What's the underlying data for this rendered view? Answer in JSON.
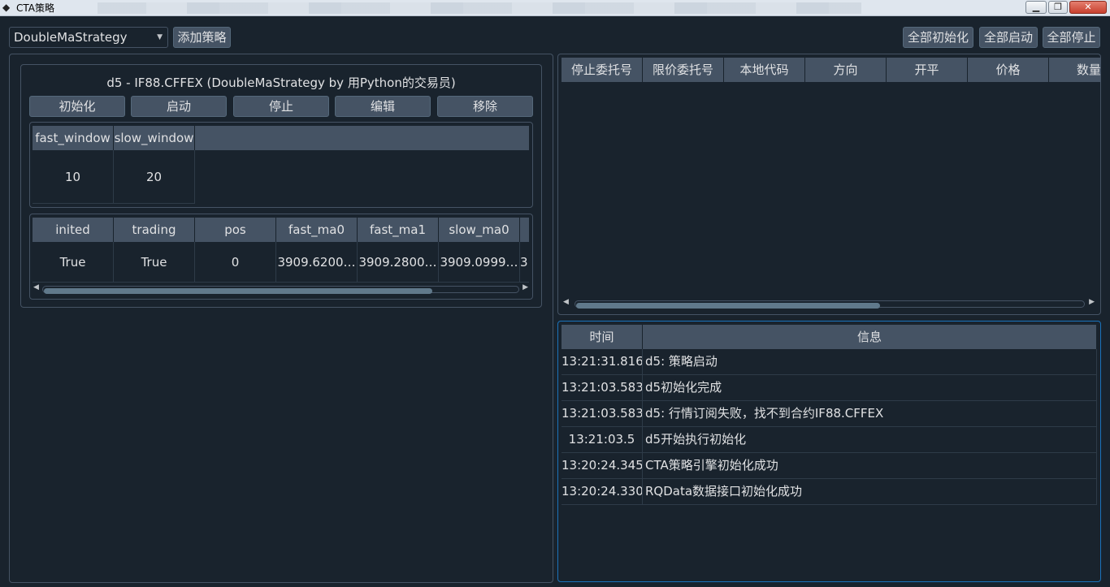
{
  "window": {
    "title": "CTA策略"
  },
  "toolbar": {
    "strategy_select": "DoubleMaStrategy",
    "add_strategy": "添加策略",
    "init_all": "全部初始化",
    "start_all": "全部启动",
    "stop_all": "全部停止"
  },
  "strategy": {
    "title": "d5  -  IF88.CFFEX  (DoubleMaStrategy by 用Python的交易员)",
    "buttons": [
      "初始化",
      "启动",
      "停止",
      "编辑",
      "移除"
    ],
    "params": {
      "headers": [
        "fast_window",
        "slow_window"
      ],
      "values": [
        "10",
        "20"
      ]
    },
    "variables": {
      "headers": [
        "inited",
        "trading",
        "pos",
        "fast_ma0",
        "fast_ma1",
        "slow_ma0"
      ],
      "values": [
        "True",
        "True",
        "0",
        "3909.6200…",
        "3909.2800…",
        "3909.0999…",
        "3"
      ]
    },
    "scroll_fraction": 0.82
  },
  "stop_orders": {
    "headers": [
      "停止委托号",
      "限价委托号",
      "本地代码",
      "方向",
      "开平",
      "价格",
      "数量"
    ],
    "scroll_fraction": 0.6
  },
  "log": {
    "headers": [
      "时间",
      "信息"
    ],
    "rows": [
      {
        "time": "13:21:31.816",
        "msg": "d5: 策略启动"
      },
      {
        "time": "13:21:03.583",
        "msg": "d5初始化完成"
      },
      {
        "time": "13:21:03.583",
        "msg": "d5: 行情订阅失败，找不到合约IF88.CFFEX"
      },
      {
        "time": "13:21:03.5",
        "msg": "d5开始执行初始化"
      },
      {
        "time": "13:20:24.345",
        "msg": "CTA策略引擎初始化成功"
      },
      {
        "time": "13:20:24.330",
        "msg": "RQData数据接口初始化成功"
      }
    ]
  },
  "colors": {
    "background": "#19232d",
    "header": "#455364",
    "focus_border": "#1a72bb"
  }
}
